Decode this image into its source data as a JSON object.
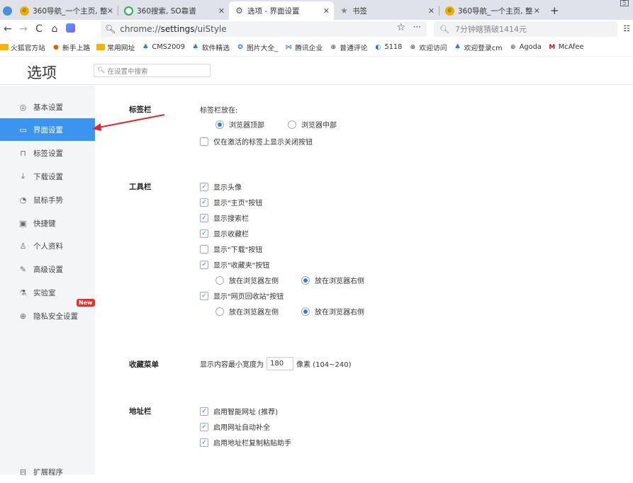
{
  "tabs": [
    {
      "label": "360导航_一个主页, 整",
      "icon": "360-nav-favicon",
      "active": false
    },
    {
      "label": "360搜索, SO靠谱",
      "icon": "360-search-favicon",
      "active": false
    },
    {
      "label": "选项 - 界面设置",
      "icon": "gear-icon",
      "active": true
    },
    {
      "label": "书签",
      "icon": "star-icon",
      "active": false
    },
    {
      "label": "360导航_一个主页, 整",
      "icon": "360-nav-favicon",
      "active": false
    }
  ],
  "address": {
    "scheme": "chrome://",
    "path_bold": "settings",
    "path_rest": "/uiStyle"
  },
  "search_box": {
    "placeholder": "7分钟瞎猜破1414元"
  },
  "bookmarks": [
    {
      "label": "火狐官方站",
      "icon": "folder"
    },
    {
      "label": "新手上路",
      "icon": "firefox"
    },
    {
      "label": "常用网址",
      "icon": "folder"
    },
    {
      "label": "CMS2009",
      "icon": "app"
    },
    {
      "label": "软件精选",
      "icon": "app"
    },
    {
      "label": "图片大全_",
      "icon": "app"
    },
    {
      "label": "腾讯企业",
      "icon": "qq"
    },
    {
      "label": "普通评论",
      "icon": "globe"
    },
    {
      "label": "5118",
      "icon": "5118"
    },
    {
      "label": "欢迎访问",
      "icon": "globe"
    },
    {
      "label": "欢迎登录cm",
      "icon": "app"
    },
    {
      "label": "Agoda",
      "icon": "globe"
    },
    {
      "label": "McAfee",
      "icon": "mcafee"
    }
  ],
  "page": {
    "title": "选项",
    "search_placeholder": "在设置中搜索"
  },
  "sidebar": [
    {
      "label": "基本设置",
      "icon": "settings-icon"
    },
    {
      "label": "界面设置",
      "icon": "window-icon",
      "active": true
    },
    {
      "label": "标签设置",
      "icon": "tab-icon"
    },
    {
      "label": "下载设置",
      "icon": "download-icon"
    },
    {
      "label": "鼠标手势",
      "icon": "mouse-icon"
    },
    {
      "label": "快捷键",
      "icon": "keyboard-icon"
    },
    {
      "label": "个人资料",
      "icon": "user-icon"
    },
    {
      "label": "高级设置",
      "icon": "advanced-icon"
    },
    {
      "label": "实验室",
      "icon": "lab-icon"
    },
    {
      "label": "隐私安全设置",
      "icon": "shield-icon",
      "badge": "New"
    },
    {
      "label": "扩展程序",
      "icon": "extension-icon"
    }
  ],
  "sections": {
    "tabbar": {
      "label": "标签栏",
      "position_label": "标签栏放在:",
      "opt_top": "浏览器顶部",
      "opt_mid": "浏览器中部",
      "close_btn_only_active": "仅在激活的标签上显示关闭按钮"
    },
    "toolbar": {
      "label": "工具栏",
      "show_avatar": "显示头像",
      "show_home": "显示\"主页\"按钮",
      "show_search": "显示搜索栏",
      "show_favbar": "显示收藏栏",
      "show_download": "显示\"下载\"按钮",
      "show_favorites": "显示\"收藏夹\"按钮",
      "fav_left": "放在浏览器左侧",
      "fav_right": "放在浏览器右侧",
      "show_recycle": "显示\"网页回收站\"按钮",
      "rec_left": "放在浏览器左侧",
      "rec_right": "放在浏览器右侧"
    },
    "favmenu": {
      "label": "收藏菜单",
      "prefix": "显示内容最小宽度为",
      "value": "180",
      "suffix": "像素 (104~240)"
    },
    "addressbar": {
      "label": "地址栏",
      "smart": "启用智能网址 (推荐)",
      "autocomplete": "启用网址自动补全",
      "paste_helper": "启用地址栏复制粘贴助手"
    }
  },
  "colors": {
    "accent": "#3b95f0",
    "arrow": "#e0262a",
    "badge": "#e2322b"
  }
}
